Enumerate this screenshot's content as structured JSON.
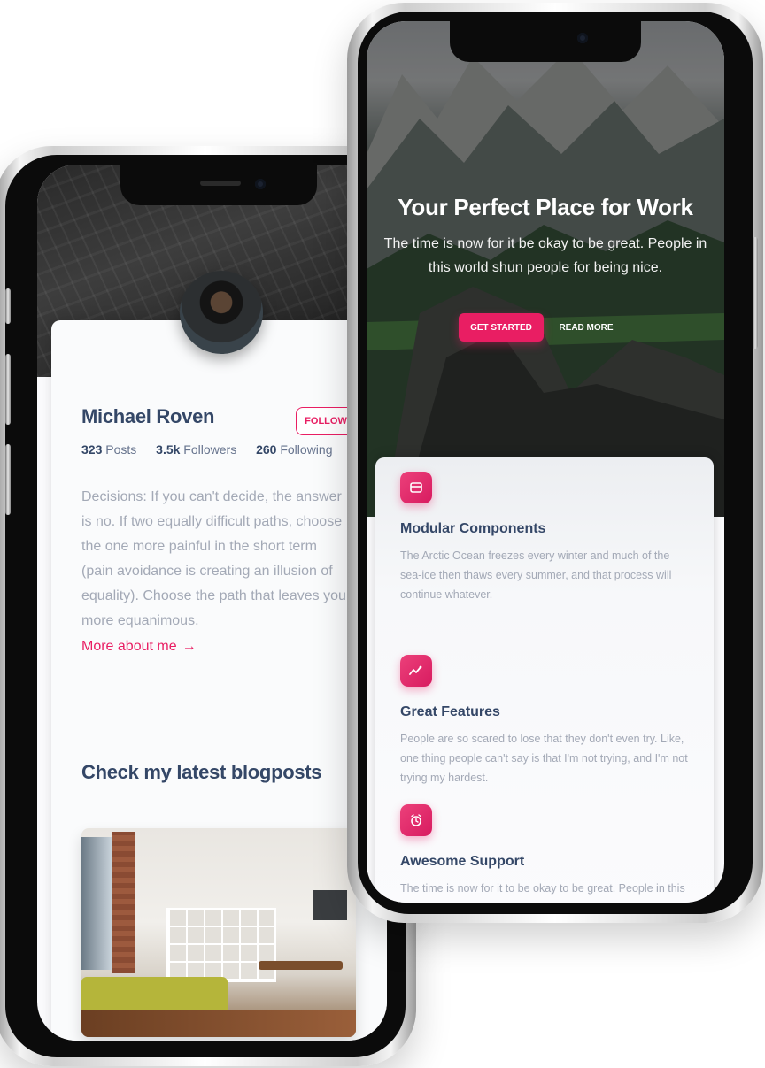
{
  "profile": {
    "name": "Michael Roven",
    "follow_label": "FOLLOW",
    "stats": [
      {
        "count": "323",
        "label": "Posts"
      },
      {
        "count": "3.5k",
        "label": "Followers"
      },
      {
        "count": "260",
        "label": "Following"
      }
    ],
    "bio": "Decisions: If you can't decide, the answer is no. If two equally difficult paths, choose the one more painful in the short term (pain avoidance is creating an illusion of equality). Choose the path that leaves you more equanimous.",
    "more_link": "More about me",
    "blog_heading": "Check my latest blogposts"
  },
  "landing": {
    "hero_title": "Your Perfect Place for Work",
    "hero_subtitle": "The time is now for it be okay to be great. People in this world shun people for being nice.",
    "primary_button": "GET STARTED",
    "secondary_button": "READ MORE",
    "features": [
      {
        "icon": "credit-card-icon",
        "title": "Modular Components",
        "description": "The Arctic Ocean freezes every winter and much of the sea-ice then thaws every summer, and that process will continue whatever."
      },
      {
        "icon": "sparkline-chart-icon",
        "title": "Great Features",
        "description": "People are so scared to lose that they don't even try. Like, one thing people can't say is that I'm not trying, and I'm not trying my hardest."
      },
      {
        "icon": "alarm-clock-icon",
        "title": "Awesome Support",
        "description": "The time is now for it to be okay to be great. People in this"
      }
    ]
  },
  "colors": {
    "accent": "#e91e63",
    "heading": "#344767",
    "muted_text": "#a3a9b6"
  }
}
